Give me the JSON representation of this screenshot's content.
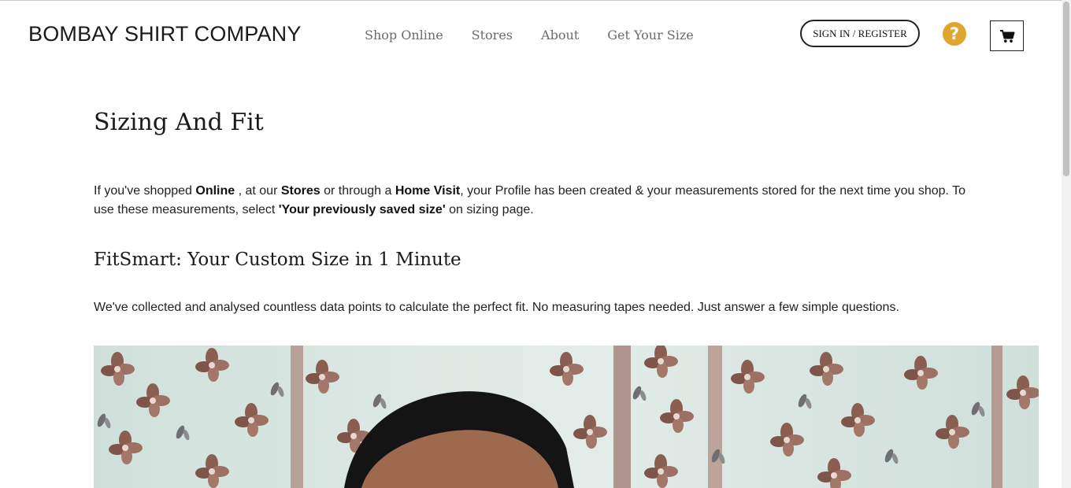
{
  "header": {
    "logo": "BOMBAY SHIRT COMPANY",
    "nav": [
      "Shop Online",
      "Stores",
      "About",
      "Get Your Size"
    ],
    "signin_label": "SIGN IN / REGISTER",
    "help_glyph": "?"
  },
  "main": {
    "title": "Sizing And Fit",
    "intro": {
      "p1": "If you've shopped ",
      "b1": "Online",
      "p2": " , at our ",
      "b2": "Stores",
      "p3": " or through a ",
      "b3": "Home Visit",
      "p4": ", your Profile has been created & your measurements stored for the next time you shop. To use these measurements, select ",
      "b4": "'Your previously saved size'",
      "p5": " on sizing page."
    },
    "subtitle": "FitSmart: Your Custom Size in 1 Minute",
    "description": "We've collected and analysed countless data points to calculate the perfect fit. No measuring tapes needed. Just answer a few simple questions."
  },
  "colors": {
    "help_icon": "#e0a431",
    "nav_text": "#6b6b6b",
    "video_background": "#d8e4e0",
    "curtain_flower": "#8a5f52"
  },
  "icons": {
    "help": "question-circle-icon",
    "cart": "shopping-cart-icon"
  }
}
